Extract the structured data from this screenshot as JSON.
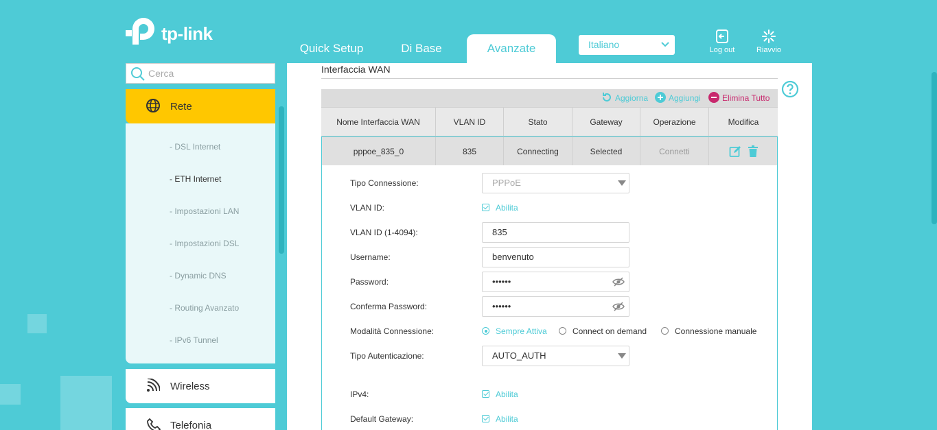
{
  "brand": {
    "logo_text": "tp-link"
  },
  "tabs": [
    {
      "label": "Quick Setup"
    },
    {
      "label": "Di Base"
    },
    {
      "label": "Avanzate"
    }
  ],
  "language": {
    "selected": "Italiano"
  },
  "header_buttons": {
    "logout": "Log out",
    "reboot": "Riavvio"
  },
  "sidebar": {
    "search_placeholder": "Cerca",
    "sections": [
      {
        "label": "Rete",
        "icon": "globe-icon"
      },
      {
        "label": "Wireless",
        "icon": "wifi-icon"
      },
      {
        "label": "Telefonia",
        "icon": "phone-icon"
      }
    ],
    "sub_items": [
      {
        "label": "- DSL Internet"
      },
      {
        "label": "- ETH Internet"
      },
      {
        "label": "- Impostazioni LAN"
      },
      {
        "label": "- Impostazioni DSL"
      },
      {
        "label": "- Dynamic DNS"
      },
      {
        "label": "- Routing Avanzato"
      },
      {
        "label": "- IPv6 Tunnel"
      }
    ]
  },
  "main": {
    "title": "Interfaccia WAN",
    "toolbar": {
      "refresh": "Aggiorna",
      "add": "Aggiungi",
      "delete_all": "Elimina Tutto"
    },
    "table": {
      "headers": [
        "Nome Interfaccia WAN",
        "VLAN ID",
        "Stato",
        "Gateway",
        "Operazione",
        "Modifica"
      ],
      "row": {
        "name": "pppoe_835_0",
        "vlan_id": "835",
        "status": "Connecting",
        "gateway": "Selected",
        "operation": "Connetti"
      }
    },
    "form": {
      "connection_type_label": "Tipo Connessione:",
      "connection_type_value": "PPPoE",
      "vlan_label": "VLAN ID:",
      "vlan_enable": "Abilita",
      "vlan_id_label": "VLAN ID (1-4094):",
      "vlan_id_value": "835",
      "username_label": "Username:",
      "username_value": "benvenuto",
      "password_label": "Password:",
      "password_value": "••••••",
      "confirm_label": "Conferma Password:",
      "confirm_value": "••••••",
      "mode_label": "Modalità Connessione:",
      "mode_options": [
        "Sempre Attiva",
        "Connect on demand",
        "Connessione manuale"
      ],
      "auth_label": "Tipo Autenticazione:",
      "auth_value": "AUTO_AUTH",
      "ipv4_label": "IPv4:",
      "ipv4_enable": "Abilita",
      "gateway_label": "Default Gateway:",
      "gateway_enable": "Abilita"
    }
  },
  "colors": {
    "accent": "#4ecbd6",
    "highlight": "#ffc700",
    "danger": "#c8286d"
  }
}
